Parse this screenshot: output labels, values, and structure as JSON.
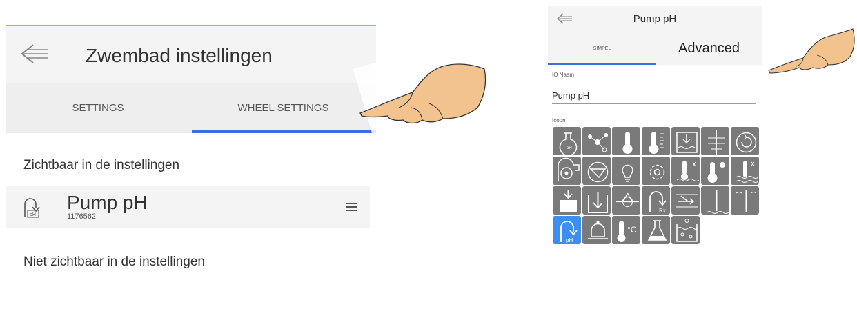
{
  "left": {
    "title": "Zwembad instellingen",
    "tabs": [
      "SETTINGS",
      "WHEEL SETTINGS"
    ],
    "active_tab": "WHEEL SETTINGS",
    "visible_section": "Zichtbaar in de instellingen",
    "item": {
      "icon": "ph-pump-icon",
      "icon_label": "pH",
      "title": "Pump pH",
      "id": "1176562"
    },
    "hidden_section": "Niet zichtbaar in de instellingen"
  },
  "right": {
    "title": "Pump pH",
    "tabs": [
      "SIMPEL",
      "Advanced"
    ],
    "active_tab": "SIMPEL",
    "io_name_label": "IO Naam",
    "io_name_value": "Pump pH",
    "icon_label": "Icoon",
    "icons": [
      {
        "name": "flask-ph-icon",
        "text": "pH"
      },
      {
        "name": "molecule-icon"
      },
      {
        "name": "thermometer-icon"
      },
      {
        "name": "thermometer-scale-icon"
      },
      {
        "name": "water-level-down-icon"
      },
      {
        "name": "level-probe-icon"
      },
      {
        "name": "circulation-icon"
      },
      {
        "name": "blower-icon"
      },
      {
        "name": "valve-icon"
      },
      {
        "name": "lightbulb-icon"
      },
      {
        "name": "gear-icon"
      },
      {
        "name": "water-heater-icon"
      },
      {
        "name": "solar-thermometer-icon"
      },
      {
        "name": "probe-in-water-icon"
      },
      {
        "name": "fill-down-icon"
      },
      {
        "name": "drain-down-icon"
      },
      {
        "name": "heat-pump-icon"
      },
      {
        "name": "rx-pump-icon",
        "text": "Rx"
      },
      {
        "name": "flow-switch-icon"
      },
      {
        "name": "level-sensor-icon"
      },
      {
        "name": "electrode-icon"
      },
      {
        "name": "ph-pump-icon",
        "text": "pH",
        "selected": true
      },
      {
        "name": "bell-icon"
      },
      {
        "name": "thermometer-celsius-icon",
        "text": "°C"
      },
      {
        "name": "lab-flask-icon"
      },
      {
        "name": "pool-icon"
      }
    ]
  },
  "colors": {
    "accent": "#3b6ee0",
    "tile": "#7a7a7a",
    "tile_selected": "#3d8ef0",
    "header_bg": "#f4f4f4"
  }
}
